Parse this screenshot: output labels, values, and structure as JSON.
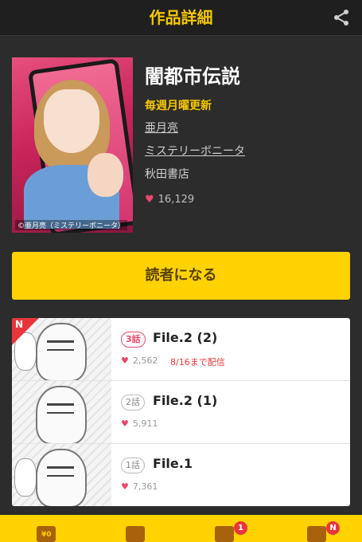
{
  "header": {
    "title": "作品詳細",
    "share_icon": "share-icon"
  },
  "work": {
    "title": "闇都市伝説",
    "schedule": "毎週月曜更新",
    "author": "亜月亮",
    "magazine": "ミステリーボニータ",
    "publisher": "秋田書店",
    "likes": "16,129",
    "cover_credit": "©亜月亮（ミステリーボニータ）"
  },
  "reader_button": {
    "label": "読者になる"
  },
  "episodes": [
    {
      "badge": "3話",
      "title": "File.2 (2)",
      "likes": "2,562",
      "deadline": "8/16まで配信",
      "new": "N"
    },
    {
      "badge": "2話",
      "title": "File.2 (1)",
      "likes": "5,911"
    },
    {
      "badge": "1話",
      "title": "File.1",
      "likes": "7,361"
    }
  ],
  "bottom_nav": {
    "tabs": [
      {
        "icon": "wallet-icon",
        "label": "¥0"
      },
      {
        "icon": "bookshelf-icon"
      },
      {
        "icon": "book-icon",
        "badge": "1"
      },
      {
        "icon": "user-icon",
        "badge": "N"
      }
    ]
  },
  "colors": {
    "accent": "#ffd200",
    "heart": "#e8486b",
    "header_text": "#f5c800"
  }
}
